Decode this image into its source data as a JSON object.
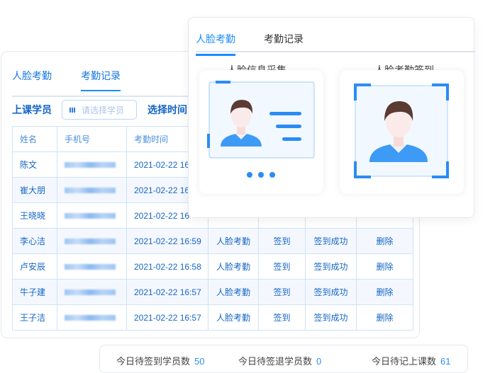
{
  "back": {
    "tabs": [
      {
        "label": "人脸考勤",
        "active": false
      },
      {
        "label": "考勤记录",
        "active": true
      }
    ],
    "filter": {
      "student_label": "上课学员",
      "student_placeholder": "请选择学员",
      "time_label": "选择时间"
    },
    "columns": [
      "姓名",
      "手机号",
      "考勤时间"
    ],
    "rows": [
      {
        "name": "陈文",
        "time": "2021-02-22 16"
      },
      {
        "name": "崔大朋",
        "time": "2021-02-22 16"
      },
      {
        "name": "王晓晓",
        "time": "2021-02-22 16"
      },
      {
        "name": "李心洁",
        "time": "2021-02-22 16:59",
        "type": "人脸考勤",
        "action": "签到",
        "result": "签到成功",
        "op": "删除"
      },
      {
        "name": "卢安辰",
        "time": "2021-02-22 16:58",
        "type": "人脸考勤",
        "action": "签到",
        "result": "签到成功",
        "op": "删除"
      },
      {
        "name": "牛子建",
        "time": "2021-02-22 16:57",
        "type": "人脸考勤",
        "action": "签到",
        "result": "签到成功",
        "op": "删除"
      },
      {
        "name": "王子洁",
        "time": "2021-02-22 16:57",
        "type": "人脸考勤",
        "action": "签到",
        "result": "签到成功",
        "op": "删除"
      }
    ]
  },
  "front": {
    "tabs": [
      {
        "label": "人脸考勤",
        "active": true
      },
      {
        "label": "考勤记录",
        "active": false
      }
    ],
    "collect_label": "人脸信息采集",
    "checkin_label": "人脸考勤签到"
  },
  "stats": [
    {
      "label": "今日待签到学员数",
      "value": "50"
    },
    {
      "label": "今日待签退学员数",
      "value": "0"
    },
    {
      "label": "今日待记上课数",
      "value": "61"
    }
  ],
  "colors": {
    "accent": "#1a8cff",
    "text_blue": "#1566c7"
  }
}
